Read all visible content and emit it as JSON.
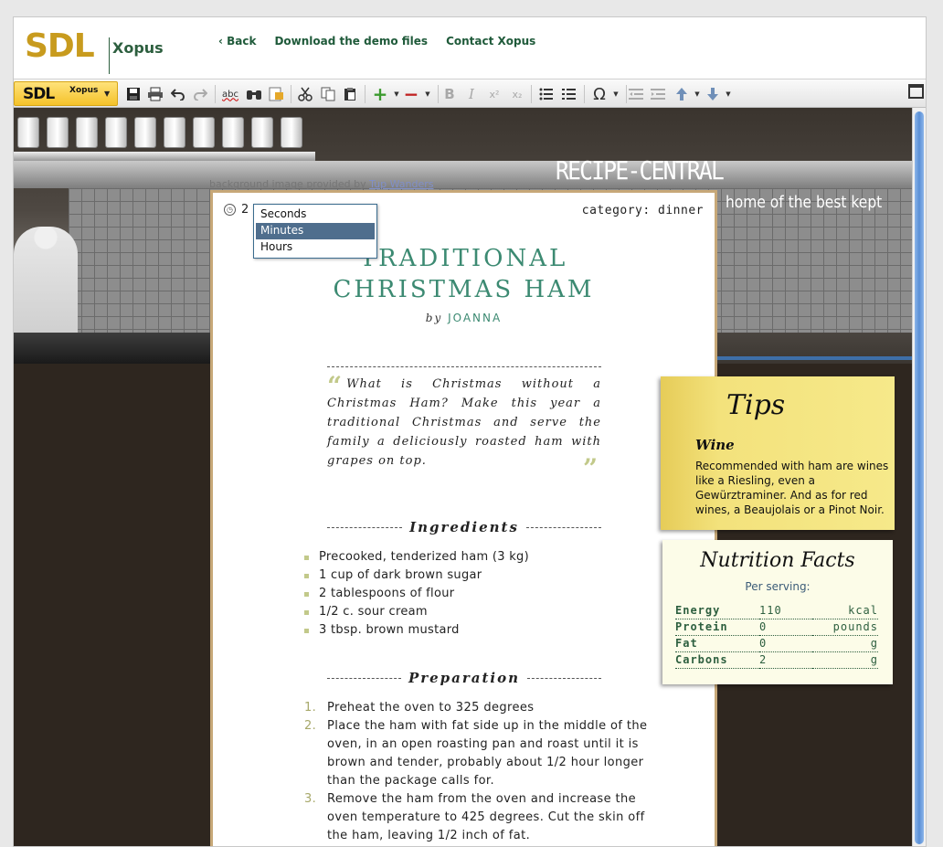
{
  "header": {
    "logo_sdl": "SDL",
    "logo_product": "Xopus",
    "nav": [
      "‹ Back",
      "Download the demo files",
      "Contact Xopus"
    ]
  },
  "toolbar": {
    "brand_sdl": "SDL",
    "brand_product": "Xopus",
    "icons": [
      "save-icon",
      "print-icon",
      "undo-icon",
      "redo-icon",
      "spellcheck-icon",
      "find-icon",
      "find-replace-icon",
      "cut-icon",
      "copy-icon",
      "paste-icon",
      "insert-icon",
      "remove-icon",
      "bold-icon",
      "italic-icon",
      "superscript-icon",
      "subscript-icon",
      "bullet-list-icon",
      "numbered-list-icon",
      "special-character-icon",
      "outdent-icon",
      "indent-icon",
      "move-up-icon",
      "move-down-icon",
      "maximize-icon"
    ],
    "spellcheck_label": "abc",
    "special_char_label": "Ω",
    "superscript_label": "x²",
    "subscript_label": "x₂"
  },
  "background": {
    "credit_text": "background image provided by",
    "credit_link": "Tup Wanders",
    "site_title": "RECIPE-CENTRAL",
    "site_tagline": "home of the best kept kitche"
  },
  "recipe": {
    "time_value": "2",
    "category": "category: dinner",
    "title_line1": "TRADITIONAL",
    "title_line2": "CHRISTMAS HAM",
    "by_label": "by",
    "author": "JOANNA",
    "quote": "What is Christmas without a Christmas Ham? Make this year a traditional Christmas and serve the family a deliciously roasted ham with grapes on top.",
    "quote_open": "“",
    "quote_close": "”",
    "ingredients_heading": "Ingredients",
    "ingredients": [
      "Precooked, tenderized ham (3 kg)",
      "1 cup of dark brown sugar",
      "2 tablespoons of flour",
      "1/2 c. sour cream",
      "3 tbsp. brown mustard"
    ],
    "preparation_heading": "Preparation",
    "preparation": [
      {
        "num": "1.",
        "text": "Preheat the oven to 325 degrees"
      },
      {
        "num": "2.",
        "text": "Place the ham with fat side up in the middle of the oven, in an open roasting pan and roast until it is brown and tender, probably about 1/2 hour longer than the package calls for."
      },
      {
        "num": "3.",
        "text": "Remove the ham from the oven and increase the oven temperature to 425 degrees. Cut the skin off the ham, leaving 1/2 inch of fat."
      }
    ]
  },
  "unit_menu": {
    "options": [
      "Seconds",
      "Minutes",
      "Hours"
    ],
    "selected": "Minutes"
  },
  "tips": {
    "title": "Tips",
    "subtitle": "Wine",
    "body": "Recommended with ham are wines like a Riesling, even a Gewürztraminer. And as for red wines, a Beaujolais or a Pinot Noir."
  },
  "nutrition": {
    "title": "Nutrition Facts",
    "per_serving": "Per serving:",
    "rows": [
      {
        "name": "Energy",
        "value": "110",
        "unit": "kcal"
      },
      {
        "name": "Protein",
        "value": "0",
        "unit": "pounds"
      },
      {
        "name": "Fat",
        "value": "0",
        "unit": "g"
      },
      {
        "name": "Carbons",
        "value": "2",
        "unit": "g"
      }
    ]
  },
  "colors": {
    "brand_gold": "#c89b1e",
    "brand_green": "#2d5f3f",
    "recipe_accent": "#3c8a72",
    "tips_yellow": "#f3e27c",
    "menu_selected": "#4f6e8d"
  }
}
